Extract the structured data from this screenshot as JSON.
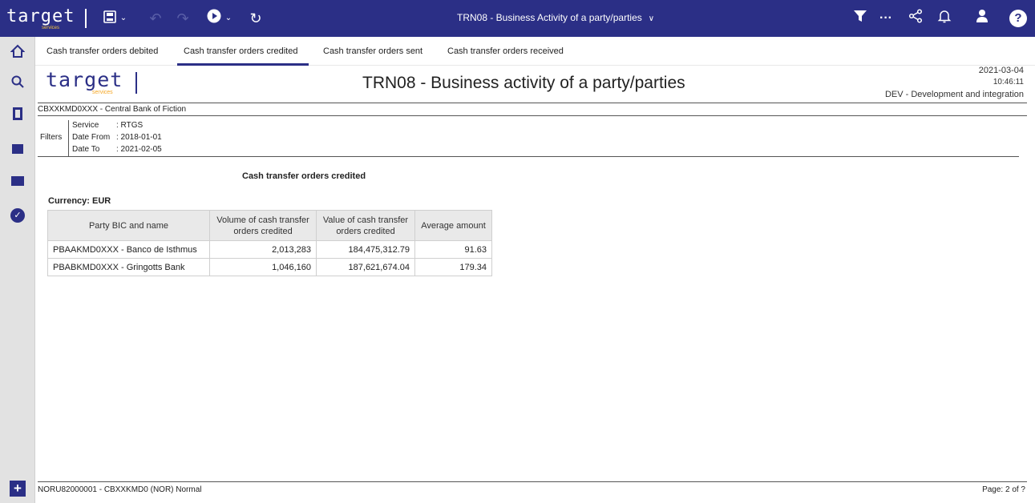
{
  "header": {
    "logo_text": "target",
    "logo_sub": "services",
    "title": "TRN08 - Business Activity of a party/parties",
    "icons": [
      "save-icon",
      "chevron-down-icon",
      "undo-icon",
      "redo-icon",
      "play-icon",
      "chevron-down-icon",
      "refresh-icon",
      "filter-icon",
      "more-icon",
      "share-icon",
      "notification-icon",
      "user-icon",
      "help-icon"
    ]
  },
  "tabs": [
    {
      "label": "Cash transfer orders debited",
      "active": false
    },
    {
      "label": "Cash transfer orders credited",
      "active": true
    },
    {
      "label": "Cash transfer orders sent",
      "active": false
    },
    {
      "label": "Cash transfer orders received",
      "active": false
    }
  ],
  "sidebar": {
    "icons": [
      "home-icon",
      "search-icon",
      "document-icon",
      "folder-icon",
      "team-folder-icon",
      "check-circle-icon",
      "add-icon"
    ]
  },
  "report": {
    "logo_text": "target",
    "logo_sub": "services",
    "title": "TRN08 - Business activity of a party/parties",
    "date": "2021-03-04",
    "time": "10:46:11",
    "environment": "DEV - Development and integration",
    "bank": "CBXXKMD0XXX - Central Bank of Fiction",
    "filters": {
      "label": "Filters",
      "rows": [
        {
          "key": "Service",
          "value": ": RTGS"
        },
        {
          "key": "Date From",
          "value": ": 2018-01-01"
        },
        {
          "key": "Date To",
          "value": ": 2021-02-05"
        }
      ]
    },
    "section_title": "Cash transfer orders credited",
    "currency_label": "Currency:",
    "currency": "EUR",
    "table": {
      "headers": [
        "Party BIC and name",
        "Volume of cash transfer orders credited",
        "Value of cash transfer orders credited",
        "Average amount"
      ],
      "rows": [
        [
          "PBAAKMD0XXX - Banco de Isthmus",
          "2,013,283",
          "184,475,312.79",
          "91.63"
        ],
        [
          "PBABKMD0XXX - Gringotts Bank",
          "1,046,160",
          "187,621,674.04",
          "179.34"
        ]
      ]
    },
    "footer_left": "NORU82000001 - CBXXKMD0 (NOR) Normal",
    "footer_right": "Page: 2 of ?"
  },
  "colors": {
    "brand": "#2b2f86",
    "accent": "#f5a623",
    "sidebar_bg": "#e2e2e2",
    "table_header_bg": "#e9e9e9"
  }
}
